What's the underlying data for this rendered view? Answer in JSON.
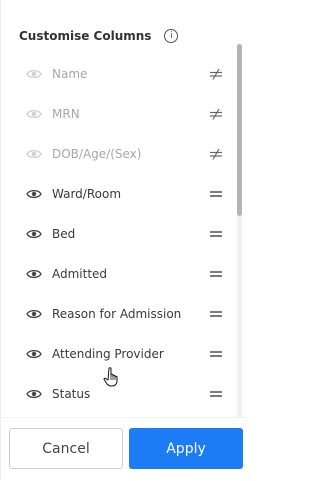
{
  "header": {
    "title": "Customise Columns",
    "info_icon": "i"
  },
  "columns": [
    {
      "label": "Name",
      "enabled": false,
      "handle": "not-equal-icon"
    },
    {
      "label": "MRN",
      "enabled": false,
      "handle": "not-equal-icon"
    },
    {
      "label": "DOB/Age/(Sex)",
      "enabled": false,
      "handle": "not-equal-icon"
    },
    {
      "label": "Ward/Room",
      "enabled": true,
      "handle": "drag-handle-icon"
    },
    {
      "label": "Bed",
      "enabled": true,
      "handle": "drag-handle-icon"
    },
    {
      "label": "Admitted",
      "enabled": true,
      "handle": "drag-handle-icon"
    },
    {
      "label": "Reason for Admission",
      "enabled": true,
      "handle": "drag-handle-icon"
    },
    {
      "label": "Attending Provider",
      "enabled": true,
      "handle": "drag-handle-icon"
    },
    {
      "label": "Status",
      "enabled": true,
      "handle": "drag-handle-icon"
    }
  ],
  "footer": {
    "cancel_label": "Cancel",
    "apply_label": "Apply"
  },
  "colors": {
    "accent": "#1b7cf6",
    "disabled_text": "#a7a7a7",
    "active_text": "#3a3a3a"
  }
}
